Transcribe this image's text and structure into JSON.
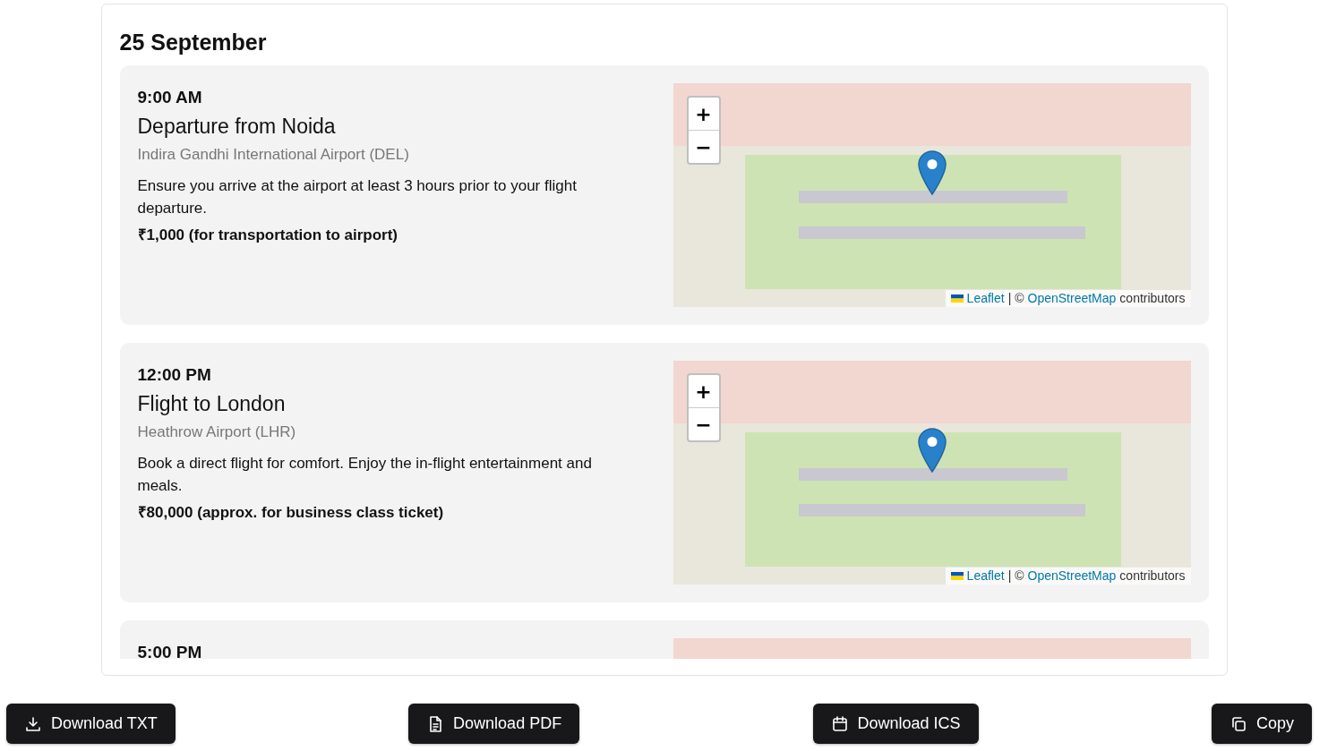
{
  "day": {
    "title": "25 September",
    "events": [
      {
        "time": "9:00 AM",
        "title": "Departure from Noida",
        "location": "Indira Gandhi International Airport (DEL)",
        "description": "Ensure you arrive at the airport at least 3 hours prior to your flight departure.",
        "cost": "₹1,000 (for transportation to airport)",
        "map": {
          "zoom_in": "+",
          "zoom_out": "−",
          "leaflet": "Leaflet",
          "separator": "| ©",
          "osm": "OpenStreetMap",
          "suffix": "contributors"
        }
      },
      {
        "time": "12:00 PM",
        "title": "Flight to London",
        "location": "Heathrow Airport (LHR)",
        "description": "Book a direct flight for comfort. Enjoy the in-flight entertainment and meals.",
        "cost": "₹80,000 (approx. for business class ticket)",
        "map": {
          "zoom_in": "+",
          "zoom_out": "−",
          "leaflet": "Leaflet",
          "separator": "| ©",
          "osm": "OpenStreetMap",
          "suffix": "contributors"
        }
      },
      {
        "time": "5:00 PM"
      }
    ]
  },
  "actions": [
    {
      "label": "Download TXT",
      "kind": "download"
    },
    {
      "label": "Download PDF",
      "kind": "document"
    },
    {
      "label": "Download ICS",
      "kind": "calendar"
    },
    {
      "label": "Copy",
      "kind": "copy"
    }
  ]
}
